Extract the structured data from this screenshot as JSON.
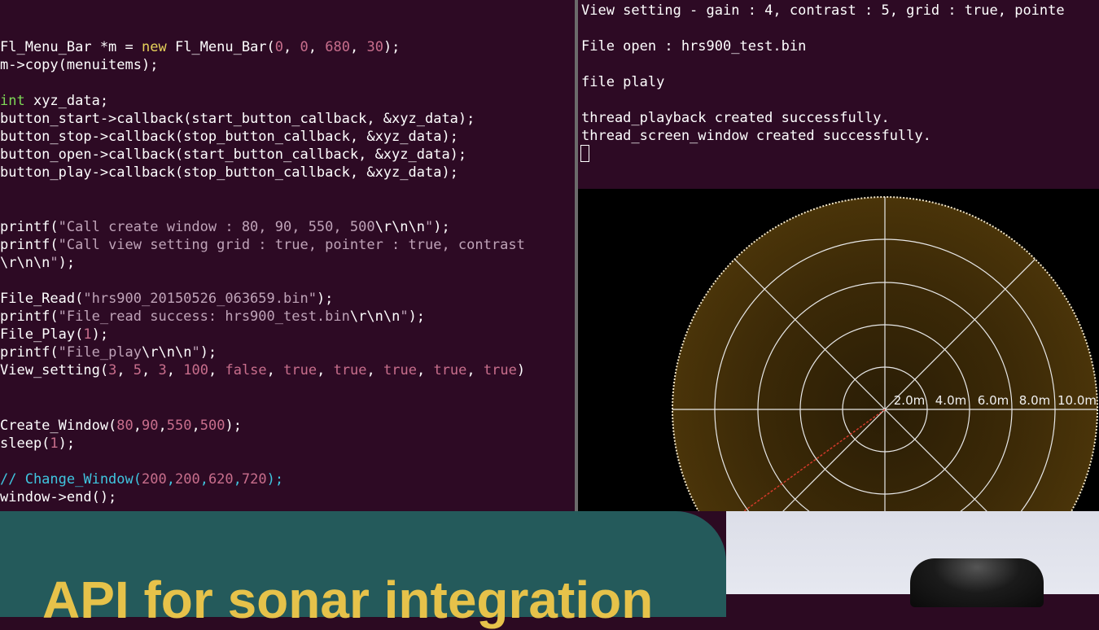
{
  "code_pane": {
    "lines": [
      {
        "segments": [
          {
            "t": "",
            "c": "#ffffff"
          }
        ]
      },
      {
        "segments": [
          {
            "t": "Fl_Menu_Bar *m = ",
            "c": "#ffffff"
          },
          {
            "t": "new",
            "c": "#e6d25a"
          },
          {
            "t": " Fl_Menu_Bar(",
            "c": "#ffffff"
          },
          {
            "t": "0",
            "c": "#c86e8c"
          },
          {
            "t": ", ",
            "c": "#ffffff"
          },
          {
            "t": "0",
            "c": "#c86e8c"
          },
          {
            "t": ", ",
            "c": "#ffffff"
          },
          {
            "t": "680",
            "c": "#c86e8c"
          },
          {
            "t": ", ",
            "c": "#ffffff"
          },
          {
            "t": "30",
            "c": "#c86e8c"
          },
          {
            "t": ");",
            "c": "#ffffff"
          }
        ]
      },
      {
        "segments": [
          {
            "t": "m->copy(menuitems);",
            "c": "#ffffff"
          }
        ]
      },
      {
        "segments": [
          {
            "t": "int",
            "c": "#7ed957"
          },
          {
            "t": " xyz_data;",
            "c": "#ffffff"
          }
        ]
      },
      {
        "segments": [
          {
            "t": "button_start->callback(start_button_callback, &xyz_data);",
            "c": "#ffffff"
          }
        ]
      },
      {
        "segments": [
          {
            "t": "button_stop->callback(stop_button_callback, &xyz_data);",
            "c": "#ffffff"
          }
        ]
      },
      {
        "segments": [
          {
            "t": "button_open->callback(start_button_callback, &xyz_data);",
            "c": "#ffffff"
          }
        ]
      },
      {
        "segments": [
          {
            "t": "button_play->callback(stop_button_callback, &xyz_data);",
            "c": "#ffffff"
          }
        ]
      },
      {
        "segments": [
          {
            "t": "printf(",
            "c": "#ffffff"
          },
          {
            "t": "\"Call create window : 80, 90, 550, 500",
            "c": "#bfa3b8"
          },
          {
            "t": "\\r\\n\\n",
            "c": "#ffffff"
          },
          {
            "t": "\"",
            "c": "#bfa3b8"
          },
          {
            "t": ");",
            "c": "#ffffff"
          }
        ]
      },
      {
        "segments": [
          {
            "t": "printf(",
            "c": "#ffffff"
          },
          {
            "t": "\"Call view setting grid : true, pointer : true, contrast",
            "c": "#bfa3b8"
          }
        ]
      },
      {
        "segments": [
          {
            "t": "\\r\\n\\n",
            "c": "#ffffff"
          },
          {
            "t": "\"",
            "c": "#bfa3b8"
          },
          {
            "t": ");",
            "c": "#ffffff"
          }
        ]
      },
      {
        "segments": [
          {
            "t": "File_Read(",
            "c": "#ffffff"
          },
          {
            "t": "\"hrs900_20150526_063659.bin\"",
            "c": "#bfa3b8"
          },
          {
            "t": ");",
            "c": "#ffffff"
          }
        ]
      },
      {
        "segments": [
          {
            "t": "printf(",
            "c": "#ffffff"
          },
          {
            "t": "\"File_read success: hrs900_test.bin",
            "c": "#bfa3b8"
          },
          {
            "t": "\\r\\n\\n",
            "c": "#ffffff"
          },
          {
            "t": "\"",
            "c": "#bfa3b8"
          },
          {
            "t": ");",
            "c": "#ffffff"
          }
        ]
      },
      {
        "segments": [
          {
            "t": "File_Play(",
            "c": "#ffffff"
          },
          {
            "t": "1",
            "c": "#c86e8c"
          },
          {
            "t": ");",
            "c": "#ffffff"
          }
        ]
      },
      {
        "segments": [
          {
            "t": "printf(",
            "c": "#ffffff"
          },
          {
            "t": "\"File_play",
            "c": "#bfa3b8"
          },
          {
            "t": "\\r\\n\\n",
            "c": "#ffffff"
          },
          {
            "t": "\"",
            "c": "#bfa3b8"
          },
          {
            "t": ");",
            "c": "#ffffff"
          }
        ]
      },
      {
        "segments": [
          {
            "t": "View_setting(",
            "c": "#ffffff"
          },
          {
            "t": "3",
            "c": "#c86e8c"
          },
          {
            "t": ", ",
            "c": "#ffffff"
          },
          {
            "t": "5",
            "c": "#c86e8c"
          },
          {
            "t": ", ",
            "c": "#ffffff"
          },
          {
            "t": "3",
            "c": "#c86e8c"
          },
          {
            "t": ", ",
            "c": "#ffffff"
          },
          {
            "t": "100",
            "c": "#c86e8c"
          },
          {
            "t": ", ",
            "c": "#ffffff"
          },
          {
            "t": "false",
            "c": "#c86e8c"
          },
          {
            "t": ", ",
            "c": "#ffffff"
          },
          {
            "t": "true",
            "c": "#c86e8c"
          },
          {
            "t": ", ",
            "c": "#ffffff"
          },
          {
            "t": "true",
            "c": "#c86e8c"
          },
          {
            "t": ", ",
            "c": "#ffffff"
          },
          {
            "t": "true",
            "c": "#c86e8c"
          },
          {
            "t": ", ",
            "c": "#ffffff"
          },
          {
            "t": "true",
            "c": "#c86e8c"
          },
          {
            "t": ", ",
            "c": "#ffffff"
          },
          {
            "t": "true",
            "c": "#c86e8c"
          },
          {
            "t": ")",
            "c": "#ffffff"
          }
        ]
      },
      {
        "segments": [
          {
            "t": "Create_Window(",
            "c": "#ffffff"
          },
          {
            "t": "80",
            "c": "#c86e8c"
          },
          {
            "t": ",",
            "c": "#ffffff"
          },
          {
            "t": "90",
            "c": "#c86e8c"
          },
          {
            "t": ",",
            "c": "#ffffff"
          },
          {
            "t": "550",
            "c": "#c86e8c"
          },
          {
            "t": ",",
            "c": "#ffffff"
          },
          {
            "t": "500",
            "c": "#c86e8c"
          },
          {
            "t": ");",
            "c": "#ffffff"
          }
        ]
      },
      {
        "segments": [
          {
            "t": "sleep(",
            "c": "#ffffff"
          },
          {
            "t": "1",
            "c": "#c86e8c"
          },
          {
            "t": ");",
            "c": "#ffffff"
          }
        ]
      },
      {
        "segments": [
          {
            "t": "// Change_Window(",
            "c": "#3fc6e0"
          },
          {
            "t": "200",
            "c": "#c86e8c"
          },
          {
            "t": ",",
            "c": "#3fc6e0"
          },
          {
            "t": "200",
            "c": "#c86e8c"
          },
          {
            "t": ",",
            "c": "#3fc6e0"
          },
          {
            "t": "620",
            "c": "#c86e8c"
          },
          {
            "t": ",",
            "c": "#3fc6e0"
          },
          {
            "t": "720",
            "c": "#c86e8c"
          },
          {
            "t": ");",
            "c": "#3fc6e0"
          }
        ]
      },
      {
        "segments": [
          {
            "t": "window->end();",
            "c": "#ffffff"
          }
        ]
      }
    ]
  },
  "terminal": {
    "lines": [
      "View setting - gain : 4, contrast : 5, grid : true, pointe",
      "File open : hrs900_test.bin",
      "file plaly",
      "thread_playback created successfully.",
      "thread_screen_window created successfully."
    ]
  },
  "sonar": {
    "range_labels": [
      "2.0m",
      "4.0m",
      "6.0m",
      "8.0m",
      "10.0m"
    ],
    "colors": {
      "background": "#000000",
      "image": "#3a2806",
      "grid": "#e8e8e8",
      "beam": "#d23a2a"
    }
  },
  "banner": {
    "title": "API for sonar integration",
    "colors": {
      "panel": "#245a5b",
      "title": "#e6c24a",
      "right": "#e2e4ec"
    },
    "device_icon": "sonar-device-icon"
  }
}
